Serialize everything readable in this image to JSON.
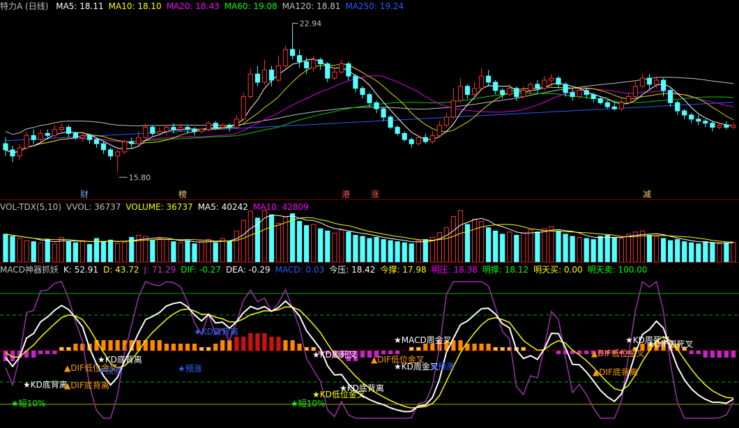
{
  "header": {
    "stock": "特力A (日线)",
    "ma": [
      {
        "label": "MA5: 18.11",
        "color": "#ffffff"
      },
      {
        "label": "MA10: 18.10",
        "color": "#ffff00"
      },
      {
        "label": "MA20: 18.43",
        "color": "#ff00ff"
      },
      {
        "label": "MA60: 19.08",
        "color": "#00ff00"
      },
      {
        "label": "MA120: 18.81",
        "color": "#c0c0c0"
      },
      {
        "label": "MA250: 19.24",
        "color": "#2a5cff"
      }
    ]
  },
  "vol_header": [
    {
      "label": "VOL-TDX(5,10)",
      "color": "#c0c0c0"
    },
    {
      "label": "VVOL: 36737",
      "color": "#c0c0c0"
    },
    {
      "label": "VOLUME: 36737",
      "color": "#ffff00"
    },
    {
      "label": "MA5: 40242",
      "color": "#ffffff"
    },
    {
      "label": "MA10: 42809",
      "color": "#ff00ff"
    }
  ],
  "macd_header": [
    {
      "label": "MACD神器抓妖",
      "color": "#c0c0c0"
    },
    {
      "label": "K: 52.91",
      "color": "#ffffff"
    },
    {
      "label": "D: 43.72",
      "color": "#ffff00"
    },
    {
      "label": "J: 71.29",
      "color": "#cc33cc"
    },
    {
      "label": "DIF: -0.27",
      "color": "#00ff00"
    },
    {
      "label": "DEA: -0.29",
      "color": "#ffffff"
    },
    {
      "label": "MACD: 0.03",
      "color": "#2a5cff"
    },
    {
      "label": "今压: 18.42",
      "color": "#ffffff"
    },
    {
      "label": "今撑: 17.98",
      "color": "#ffff00"
    },
    {
      "label": "明压: 18.38",
      "color": "#ff00ff"
    },
    {
      "label": "明撑: 18.12",
      "color": "#00ff00"
    },
    {
      "label": "明天买: 0.00",
      "color": "#ffff00"
    },
    {
      "label": "明天卖: 100.00",
      "color": "#00ff00"
    }
  ],
  "price_labels": {
    "high": "22.94",
    "low": "15.80"
  },
  "event_markers": [
    {
      "text": "财",
      "color": "#66aaff",
      "x": 115
    },
    {
      "text": "榜",
      "color": "#ffcc66",
      "x": 256
    },
    {
      "text": "港",
      "color": "#ff5555",
      "x": 490
    },
    {
      "text": "涨",
      "color": "#ff5555",
      "x": 532
    },
    {
      "text": "减",
      "color": "#ffcc66",
      "x": 922
    }
  ],
  "chart_data": {
    "type": "candlestick",
    "ylim": [
      15.3,
      23.6
    ],
    "candles": [
      [
        17.2,
        16.9,
        17.5,
        16.6
      ],
      [
        16.9,
        16.6,
        17.1,
        16.3
      ],
      [
        16.6,
        17.0,
        17.2,
        16.4
      ],
      [
        17.0,
        17.6,
        17.8,
        16.9
      ],
      [
        17.6,
        17.4,
        17.9,
        17.2
      ],
      [
        17.4,
        17.7,
        17.9,
        17.3
      ],
      [
        17.7,
        17.6,
        17.9,
        17.4
      ],
      [
        17.6,
        17.9,
        18.1,
        17.5
      ],
      [
        17.9,
        18.0,
        18.2,
        17.7
      ],
      [
        18.0,
        17.7,
        18.1,
        17.5
      ],
      [
        17.7,
        17.5,
        17.8,
        17.4
      ],
      [
        17.5,
        17.6,
        17.8,
        17.3
      ],
      [
        17.6,
        17.4,
        17.7,
        17.2
      ],
      [
        17.4,
        17.2,
        17.5,
        17.0
      ],
      [
        17.2,
        16.9,
        17.3,
        16.7
      ],
      [
        16.9,
        16.6,
        17.0,
        16.4
      ],
      [
        16.6,
        16.8,
        16.9,
        15.8
      ],
      [
        16.8,
        17.3,
        17.4,
        16.7
      ],
      [
        17.3,
        17.2,
        17.5,
        17.0
      ],
      [
        17.2,
        17.5,
        17.8,
        17.1
      ],
      [
        17.5,
        18.0,
        18.2,
        17.4
      ],
      [
        18.0,
        17.7,
        18.1,
        17.6
      ],
      [
        17.7,
        17.8,
        18.0,
        17.6
      ],
      [
        17.8,
        18.0,
        18.1,
        17.6
      ],
      [
        18.0,
        17.9,
        18.2,
        17.7
      ],
      [
        17.9,
        18.0,
        18.2,
        17.8
      ],
      [
        18.0,
        17.9,
        18.1,
        17.7
      ],
      [
        17.9,
        17.8,
        18.0,
        17.6
      ],
      [
        17.8,
        17.9,
        18.0,
        17.7
      ],
      [
        17.9,
        18.2,
        18.3,
        17.8
      ],
      [
        18.2,
        18.0,
        18.3,
        17.9
      ],
      [
        18.0,
        18.1,
        18.2,
        17.9
      ],
      [
        18.1,
        18.0,
        18.2,
        17.8
      ],
      [
        18.0,
        18.4,
        18.6,
        17.9
      ],
      [
        18.4,
        19.5,
        19.7,
        18.3
      ],
      [
        19.5,
        20.6,
        20.9,
        19.4
      ],
      [
        20.6,
        20.2,
        21.0,
        20.0
      ],
      [
        20.2,
        20.8,
        21.3,
        20.1
      ],
      [
        20.8,
        20.3,
        21.0,
        20.0
      ],
      [
        20.3,
        21.0,
        21.5,
        20.2
      ],
      [
        21.0,
        21.8,
        22.0,
        20.9
      ],
      [
        21.8,
        21.5,
        22.94,
        21.3
      ],
      [
        21.5,
        21.2,
        21.8,
        20.9
      ],
      [
        21.2,
        20.9,
        21.4,
        20.6
      ],
      [
        20.9,
        21.3,
        21.5,
        20.7
      ],
      [
        21.3,
        21.1,
        21.4,
        20.8
      ],
      [
        21.1,
        20.4,
        21.2,
        20.2
      ],
      [
        20.4,
        20.7,
        20.9,
        20.3
      ],
      [
        20.7,
        21.1,
        21.3,
        20.6
      ],
      [
        21.1,
        20.5,
        21.2,
        20.3
      ],
      [
        20.5,
        19.9,
        20.6,
        19.7
      ],
      [
        19.9,
        19.6,
        20.0,
        19.4
      ],
      [
        19.6,
        19.2,
        19.7,
        19.0
      ],
      [
        19.2,
        18.9,
        19.3,
        18.7
      ],
      [
        18.9,
        18.5,
        19.0,
        18.3
      ],
      [
        18.5,
        18.0,
        18.6,
        17.9
      ],
      [
        18.0,
        17.7,
        18.1,
        17.6
      ],
      [
        17.7,
        17.4,
        17.8,
        17.3
      ],
      [
        17.4,
        17.2,
        17.5,
        17.0
      ],
      [
        17.2,
        17.5,
        17.6,
        17.1
      ],
      [
        17.5,
        17.3,
        17.7,
        17.2
      ],
      [
        17.3,
        17.6,
        17.8,
        17.2
      ],
      [
        17.6,
        18.1,
        18.3,
        17.5
      ],
      [
        18.1,
        18.5,
        18.7,
        18.0
      ],
      [
        18.5,
        19.3,
        19.9,
        18.4
      ],
      [
        19.3,
        20.0,
        20.4,
        19.2
      ],
      [
        20.0,
        19.6,
        20.1,
        19.4
      ],
      [
        19.6,
        19.9,
        20.2,
        19.4
      ],
      [
        19.9,
        20.5,
        20.9,
        19.8
      ],
      [
        20.5,
        20.2,
        20.8,
        20.0
      ],
      [
        20.2,
        19.8,
        20.3,
        19.6
      ],
      [
        19.8,
        19.6,
        19.9,
        19.4
      ],
      [
        19.6,
        19.9,
        20.1,
        19.5
      ],
      [
        19.9,
        19.5,
        20.0,
        19.3
      ],
      [
        19.5,
        19.8,
        20.0,
        19.4
      ],
      [
        19.8,
        20.1,
        20.2,
        19.6
      ],
      [
        20.1,
        19.9,
        20.3,
        19.7
      ],
      [
        19.9,
        20.3,
        20.5,
        19.8
      ],
      [
        20.3,
        20.4,
        20.6,
        20.0
      ],
      [
        20.4,
        20.1,
        20.5,
        19.9
      ],
      [
        20.1,
        19.7,
        20.2,
        19.5
      ],
      [
        19.7,
        19.5,
        19.9,
        19.3
      ],
      [
        19.5,
        19.8,
        20.0,
        19.4
      ],
      [
        19.8,
        19.6,
        19.9,
        19.4
      ],
      [
        19.6,
        19.4,
        19.7,
        19.2
      ],
      [
        19.4,
        19.2,
        19.5,
        19.1
      ],
      [
        19.2,
        19.0,
        19.3,
        18.9
      ],
      [
        19.0,
        18.9,
        19.2,
        18.8
      ],
      [
        18.9,
        19.2,
        19.4,
        18.8
      ],
      [
        19.2,
        19.5,
        19.7,
        19.1
      ],
      [
        19.5,
        20.0,
        20.3,
        19.4
      ],
      [
        20.0,
        20.4,
        20.6,
        19.9
      ],
      [
        20.4,
        20.1,
        20.6,
        19.8
      ],
      [
        20.1,
        20.3,
        20.5,
        19.9
      ],
      [
        20.3,
        19.8,
        20.4,
        19.5
      ],
      [
        19.8,
        19.2,
        19.9,
        19.0
      ],
      [
        19.2,
        18.8,
        19.3,
        18.6
      ],
      [
        18.8,
        18.6,
        18.9,
        18.4
      ],
      [
        18.6,
        18.4,
        18.7,
        18.2
      ],
      [
        18.4,
        18.3,
        18.6,
        18.1
      ],
      [
        18.3,
        18.2,
        18.4,
        18.0
      ],
      [
        18.2,
        18.0,
        18.3,
        17.8
      ],
      [
        18.0,
        18.1,
        18.2,
        17.9
      ],
      [
        18.1,
        18.0,
        18.3,
        17.9
      ],
      [
        18.0,
        18.1,
        18.2,
        17.9
      ]
    ],
    "volume": [
      52,
      48,
      44,
      40,
      38,
      36,
      42,
      34,
      46,
      38,
      36,
      40,
      33,
      44,
      38,
      41,
      35,
      37,
      46,
      50,
      48,
      40,
      44,
      42,
      38,
      36,
      40,
      34,
      38,
      42,
      36,
      44,
      38,
      58,
      78,
      95,
      82,
      96,
      88,
      72,
      84,
      90,
      76,
      68,
      70,
      62,
      58,
      54,
      60,
      56,
      50,
      48,
      44,
      46,
      42,
      40,
      38,
      36,
      34,
      40,
      42,
      46,
      55,
      64,
      85,
      96,
      70,
      80,
      76,
      64,
      58,
      52,
      56,
      50,
      54,
      60,
      56,
      62,
      66,
      58,
      52,
      48,
      46,
      44,
      42,
      48,
      50,
      46,
      44,
      52,
      56,
      58,
      50,
      48,
      44,
      40,
      42,
      38,
      36,
      34,
      38,
      36,
      34,
      36,
      37
    ],
    "macd_hist": [
      -3,
      -3,
      -2,
      -2,
      -2,
      -1,
      -1,
      -1,
      1,
      1,
      2,
      2,
      2,
      3,
      3,
      3,
      3,
      3,
      3,
      3,
      3,
      3,
      3,
      2,
      2,
      2,
      2,
      2,
      1,
      1,
      2,
      3,
      3,
      4,
      4,
      5,
      5,
      5,
      4,
      4,
      3,
      3,
      2,
      1,
      1,
      -1,
      -1,
      -2,
      -2,
      -3,
      -3,
      -2,
      -2,
      -2,
      -1,
      -1,
      -1,
      0,
      1,
      1,
      2,
      2,
      3,
      3,
      3,
      3,
      2,
      2,
      2,
      2,
      1,
      1,
      1,
      1,
      1,
      0,
      0,
      0,
      0,
      -1,
      -1,
      -1,
      -1,
      -1,
      -1,
      -1,
      -1,
      -1,
      -1,
      -1,
      1,
      2,
      2,
      3,
      3,
      2,
      2,
      1,
      -1,
      -1,
      -2,
      -2,
      -2,
      -2,
      -2
    ],
    "signals": [
      {
        "text": "★短10%",
        "color": "#00ff00"
      },
      {
        "text": "★KD底背离",
        "color": "#ffffff"
      },
      {
        "text": "▲DIF底背离",
        "color": "#ff9900"
      },
      {
        "text": "▲DIF低位金叉",
        "color": "#ff9900"
      },
      {
        "text": "★KD底背离",
        "color": "#ffffff"
      },
      {
        "text": "★预涨",
        "color": "#3366ff"
      },
      {
        "text": "★预涨",
        "color": "#3366ff"
      },
      {
        "text": "★KD底背离",
        "color": "#3366ff"
      },
      {
        "text": "★KD周死叉",
        "color": "#ffffff"
      },
      {
        "text": "★MACD周金叉",
        "color": "#ffffff"
      },
      {
        "text": "▲DIF低位金叉",
        "color": "#ff9900"
      },
      {
        "text": "★KD周金叉",
        "color": "#ffffff"
      },
      {
        "text": "★预涨",
        "color": "#3366ff"
      },
      {
        "text": "★短10%",
        "color": "#00ff00"
      },
      {
        "text": "★KD底背离",
        "color": "#ffffff"
      },
      {
        "text": "★KD低位金叉",
        "color": "#ffff00"
      },
      {
        "text": "▲DIF低位金叉",
        "color": "#ff9900"
      },
      {
        "text": "▲DIF底背离",
        "color": "#ff9900"
      },
      {
        "text": "★KD周死叉",
        "color": "#ffffff"
      },
      {
        "text": "★DIF周死叉",
        "color": "#ffffff"
      }
    ]
  }
}
